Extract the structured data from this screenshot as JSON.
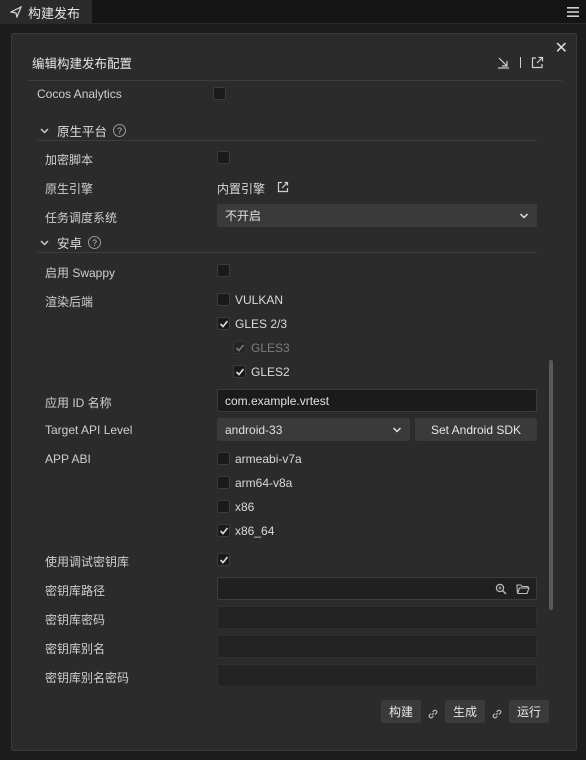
{
  "tab": {
    "title": "构建发布"
  },
  "panel": {
    "title": "编辑构建发布配置"
  },
  "analytics": {
    "label": "Cocos Analytics",
    "checked": false
  },
  "native_section": {
    "title": "原生平台"
  },
  "encrypt": {
    "label": "加密脚本",
    "checked": false
  },
  "engine": {
    "label": "原生引擎",
    "value": "内置引擎"
  },
  "scheduler": {
    "label": "任务调度系统",
    "value": "不开启"
  },
  "android_section": {
    "title": "安卓"
  },
  "swappy": {
    "label": "启用 Swappy",
    "checked": false
  },
  "render": {
    "label": "渲染后端",
    "vulkan": "VULKAN",
    "gles23": "GLES 2/3",
    "gles3": "GLES3",
    "gles2": "GLES2"
  },
  "app_id": {
    "label": "应用 ID 名称",
    "value": "com.example.vrtest"
  },
  "target_api": {
    "label": "Target API Level",
    "value": "android-33",
    "sdk_button": "Set Android SDK"
  },
  "abi": {
    "label": "APP ABI",
    "items": [
      "armeabi-v7a",
      "arm64-v8a",
      "x86",
      "x86_64"
    ]
  },
  "debug_keystore": {
    "label": "使用调试密钥库",
    "checked": true
  },
  "keystore_path": {
    "label": "密钥库路径",
    "value": ""
  },
  "keystore_password": {
    "label": "密钥库密码",
    "value": ""
  },
  "keystore_alias": {
    "label": "密钥库别名",
    "value": ""
  },
  "alias_password": {
    "label": "密钥库别名密码",
    "value": ""
  },
  "footer": {
    "build": "构建",
    "make": "生成",
    "run": "运行"
  },
  "colors": {
    "background": "#2b2b2b",
    "input": "#1b1b1b",
    "button": "#3a3a3a",
    "check": "#dcdcdc"
  }
}
